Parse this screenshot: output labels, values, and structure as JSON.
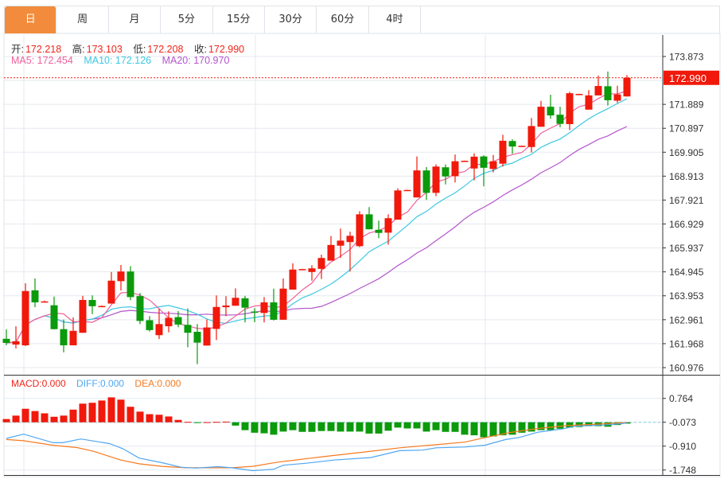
{
  "tabs": [
    {
      "label": "日",
      "active": true
    },
    {
      "label": "周"
    },
    {
      "label": "月"
    },
    {
      "label": "5分"
    },
    {
      "label": "15分"
    },
    {
      "label": "30分"
    },
    {
      "label": "60分"
    },
    {
      "label": "4时"
    }
  ],
  "ohlc_legend": {
    "open_label": "开:",
    "open": "172.218",
    "high_label": "高:",
    "high": "173.103",
    "low_label": "低:",
    "low": "172.208",
    "close_label": "收:",
    "close": "172.990"
  },
  "ma_legend": {
    "ma5": "MA5: 172.454",
    "ma10": "MA10: 172.126",
    "ma20": "MA20: 170.970"
  },
  "macd_legend": {
    "macd": "MACD:0.000",
    "diff": "DIFF:0.000",
    "dea": "DEA:0.000"
  },
  "colors": {
    "up": "#f0190b",
    "down": "#0b9a0b",
    "ma5": "#f0609a",
    "ma10": "#3cc8e0",
    "ma20": "#b455cc",
    "diff": "#4fa6f2",
    "dea": "#f57a20",
    "active_tab": "#f28c3c",
    "grid": "#e4e9ef"
  },
  "chart_data": {
    "type": "candlestick",
    "price_axis_ticks": [
      "173.873",
      "171.889",
      "170.897",
      "169.905",
      "168.913",
      "167.921",
      "166.929",
      "165.937",
      "164.945",
      "163.953",
      "162.961",
      "161.968",
      "160.976"
    ],
    "current_price": "172.990",
    "price_range": [
      160.976,
      173.873
    ],
    "candles": [
      [
        162.17,
        162.56,
        161.9,
        162.0
      ],
      [
        161.93,
        162.69,
        161.77,
        162.07
      ],
      [
        161.9,
        164.47,
        161.87,
        164.15
      ],
      [
        164.18,
        164.67,
        163.48,
        163.68
      ],
      [
        163.72,
        163.75,
        163.7,
        163.72
      ],
      [
        163.56,
        163.92,
        162.56,
        162.57
      ],
      [
        162.57,
        162.97,
        161.61,
        161.9
      ],
      [
        161.9,
        163.06,
        161.9,
        162.5
      ],
      [
        162.42,
        163.95,
        162.42,
        163.78
      ],
      [
        163.78,
        163.97,
        163.19,
        163.52
      ],
      [
        163.51,
        163.55,
        163.5,
        163.53
      ],
      [
        163.63,
        164.94,
        163.63,
        164.58
      ],
      [
        164.56,
        165.23,
        164.17,
        164.96
      ],
      [
        164.96,
        165.18,
        163.77,
        163.9
      ],
      [
        163.94,
        164.07,
        162.78,
        162.91
      ],
      [
        162.94,
        163.11,
        162.47,
        162.53
      ],
      [
        162.32,
        163.41,
        162.16,
        162.78
      ],
      [
        162.69,
        163.31,
        162.44,
        163.04
      ],
      [
        163.07,
        163.32,
        162.65,
        162.76
      ],
      [
        162.75,
        163.43,
        161.82,
        162.42
      ],
      [
        162.46,
        162.78,
        161.12,
        162.01
      ],
      [
        161.89,
        162.97,
        161.89,
        162.64
      ],
      [
        162.58,
        163.97,
        162.12,
        163.49
      ],
      [
        163.48,
        163.94,
        163.11,
        163.55
      ],
      [
        163.54,
        164.26,
        163.54,
        163.87
      ],
      [
        163.85,
        163.95,
        162.85,
        163.46
      ],
      [
        163.3,
        163.44,
        162.86,
        163.28
      ],
      [
        163.24,
        163.9,
        162.85,
        163.68
      ],
      [
        163.68,
        164.25,
        162.93,
        162.96
      ],
      [
        162.96,
        164.67,
        162.96,
        164.25
      ],
      [
        164.21,
        165.3,
        164.21,
        165.04
      ],
      [
        165.04,
        165.07,
        165.03,
        165.06
      ],
      [
        164.94,
        165.22,
        164.58,
        165.09
      ],
      [
        165.07,
        165.66,
        164.65,
        165.52
      ],
      [
        165.41,
        166.43,
        165.41,
        166.06
      ],
      [
        166.03,
        166.74,
        165.52,
        166.24
      ],
      [
        166.18,
        166.61,
        164.96,
        166.44
      ],
      [
        166.01,
        167.46,
        165.97,
        167.33
      ],
      [
        167.33,
        167.63,
        166.71,
        166.71
      ],
      [
        166.69,
        167.07,
        166.34,
        166.56
      ],
      [
        166.57,
        167.33,
        166.07,
        167.17
      ],
      [
        167.11,
        168.41,
        167.11,
        168.32
      ],
      [
        168.32,
        168.35,
        168.31,
        168.34
      ],
      [
        168.03,
        169.73,
        168.03,
        169.15
      ],
      [
        169.15,
        169.29,
        167.93,
        168.22
      ],
      [
        168.22,
        169.4,
        168.08,
        169.31
      ],
      [
        169.28,
        169.4,
        168.57,
        168.9
      ],
      [
        168.91,
        169.81,
        168.65,
        169.53
      ],
      [
        169.53,
        169.56,
        169.52,
        169.55
      ],
      [
        169.23,
        169.86,
        168.74,
        169.72
      ],
      [
        169.73,
        169.78,
        168.49,
        169.26
      ],
      [
        169.21,
        169.79,
        169.07,
        169.53
      ],
      [
        169.43,
        170.63,
        169.31,
        170.38
      ],
      [
        170.37,
        170.44,
        169.84,
        170.14
      ],
      [
        170.16,
        170.18,
        170.15,
        170.17
      ],
      [
        170.12,
        171.32,
        169.89,
        170.99
      ],
      [
        170.96,
        172.03,
        170.96,
        171.79
      ],
      [
        171.79,
        172.29,
        171.29,
        171.43
      ],
      [
        171.46,
        171.79,
        170.94,
        171.08
      ],
      [
        171.07,
        172.41,
        170.82,
        172.35
      ],
      [
        172.3,
        172.33,
        172.29,
        172.32
      ],
      [
        171.67,
        172.48,
        171.67,
        172.26
      ],
      [
        172.26,
        173.08,
        172.26,
        172.65
      ],
      [
        172.64,
        173.25,
        171.84,
        172.06
      ],
      [
        172.04,
        172.66,
        171.95,
        172.3
      ],
      [
        172.218,
        173.103,
        172.208,
        172.99
      ]
    ],
    "macd_axis_ticks": [
      "0.764",
      "-0.073",
      "-0.910",
      "-1.748"
    ],
    "macd_range": [
      -1.748,
      0.764
    ],
    "hist_baseline": -0.073,
    "hist": [
      0.04,
      0.16,
      0.4,
      0.32,
      0.24,
      0.12,
      0.16,
      0.37,
      0.58,
      0.61,
      0.69,
      0.8,
      0.72,
      0.47,
      0.3,
      0.21,
      0.19,
      0.13,
      0.01,
      -0.06,
      -0.09,
      -0.07,
      -0.06,
      -0.05,
      -0.19,
      -0.35,
      -0.44,
      -0.46,
      -0.51,
      -0.4,
      -0.35,
      -0.41,
      -0.41,
      -0.38,
      -0.38,
      -0.4,
      -0.4,
      -0.4,
      -0.47,
      -0.47,
      -0.37,
      -0.26,
      -0.29,
      -0.29,
      -0.4,
      -0.35,
      -0.41,
      -0.41,
      -0.51,
      -0.53,
      -0.6,
      -0.57,
      -0.53,
      -0.51,
      -0.44,
      -0.4,
      -0.35,
      -0.35,
      -0.3,
      -0.26,
      -0.24,
      -0.21,
      -0.21,
      -0.23,
      -0.17,
      -0.12
    ],
    "diff": [
      [
        0,
        -0.64
      ],
      [
        1.8,
        -0.49
      ],
      [
        4.9,
        -0.79
      ],
      [
        5.9,
        -0.79
      ],
      [
        7.8,
        -0.66
      ],
      [
        10.8,
        -0.82
      ],
      [
        12.2,
        -1.0
      ],
      [
        13.9,
        -1.33
      ],
      [
        16.3,
        -1.49
      ],
      [
        18.3,
        -1.65
      ],
      [
        19.8,
        -1.68
      ],
      [
        22.2,
        -1.63
      ],
      [
        23.6,
        -1.67
      ],
      [
        25.8,
        -1.77
      ],
      [
        28,
        -1.72
      ],
      [
        29,
        -1.58
      ],
      [
        31.4,
        -1.51
      ],
      [
        34.3,
        -1.4
      ],
      [
        38.2,
        -1.31
      ],
      [
        41.2,
        -1.07
      ],
      [
        43.6,
        -1.05
      ],
      [
        45,
        -0.97
      ],
      [
        48,
        -0.94
      ],
      [
        50.1,
        -0.88
      ],
      [
        52.3,
        -0.68
      ],
      [
        53.8,
        -0.6
      ],
      [
        55.7,
        -0.42
      ],
      [
        58.2,
        -0.31
      ],
      [
        59.6,
        -0.21
      ],
      [
        62.5,
        -0.17
      ],
      [
        64.5,
        -0.12
      ],
      [
        65,
        -0.09
      ]
    ],
    "dea": [
      [
        0,
        -0.68
      ],
      [
        1.8,
        -0.72
      ],
      [
        4.9,
        -0.88
      ],
      [
        7.4,
        -0.96
      ],
      [
        9.1,
        -1.09
      ],
      [
        12,
        -1.4
      ],
      [
        13.9,
        -1.53
      ],
      [
        16.3,
        -1.62
      ],
      [
        18.8,
        -1.67
      ],
      [
        23.6,
        -1.67
      ],
      [
        25.8,
        -1.62
      ],
      [
        28.5,
        -1.47
      ],
      [
        33.4,
        -1.27
      ],
      [
        38.2,
        -1.09
      ],
      [
        41.2,
        -0.97
      ],
      [
        45,
        -0.86
      ],
      [
        48,
        -0.77
      ],
      [
        49.9,
        -0.63
      ],
      [
        52.8,
        -0.43
      ],
      [
        55.7,
        -0.29
      ],
      [
        58.7,
        -0.19
      ],
      [
        62.5,
        -0.13
      ],
      [
        65,
        -0.08
      ]
    ]
  }
}
